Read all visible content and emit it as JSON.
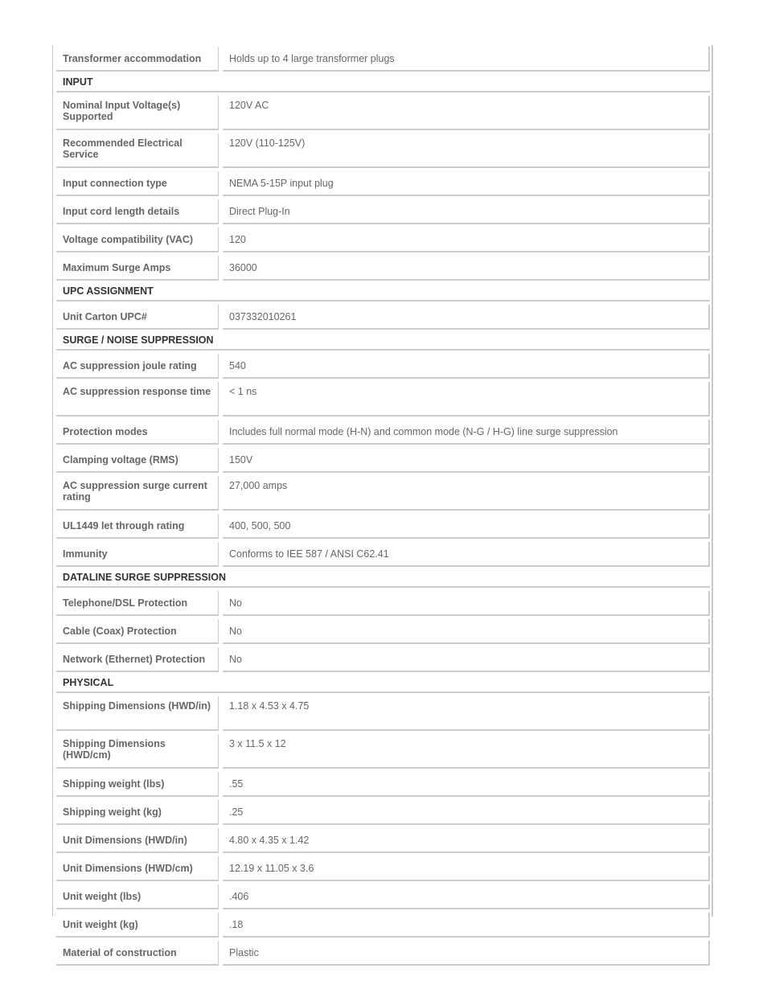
{
  "spec_table": {
    "rows": [
      {
        "type": "row",
        "label": "Transformer accommodation",
        "value": "Holds up to 4 large transformer plugs"
      },
      {
        "type": "section",
        "label": "INPUT"
      },
      {
        "type": "row",
        "label": "Nominal Input Voltage(s) Supported",
        "value": "120V AC",
        "tall": true
      },
      {
        "type": "row",
        "label": "Recommended Electrical Service",
        "value": "120V (110-125V)",
        "tall": true
      },
      {
        "type": "row",
        "label": "Input connection type",
        "value": "NEMA 5-15P input plug"
      },
      {
        "type": "row",
        "label": "Input cord length details",
        "value": "Direct Plug-In"
      },
      {
        "type": "row",
        "label": "Voltage compatibility (VAC)",
        "value": "120"
      },
      {
        "type": "row",
        "label": "Maximum Surge Amps",
        "value": "36000"
      },
      {
        "type": "section",
        "label": "UPC ASSIGNMENT"
      },
      {
        "type": "row",
        "label": "Unit Carton UPC#",
        "value": "037332010261"
      },
      {
        "type": "section",
        "label": "SURGE / NOISE SUPPRESSION"
      },
      {
        "type": "row",
        "label": "AC suppression joule rating",
        "value": "540"
      },
      {
        "type": "row",
        "label": "AC suppression response time",
        "value": "< 1 ns",
        "tall": true
      },
      {
        "type": "row",
        "label": "Protection modes",
        "value": "Includes full normal mode (H-N) and common mode (N-G / H-G) line surge suppression"
      },
      {
        "type": "row",
        "label": "Clamping voltage (RMS)",
        "value": "150V"
      },
      {
        "type": "row",
        "label": "AC suppression surge current rating",
        "value": "27,000 amps",
        "tall": true
      },
      {
        "type": "row",
        "label": "UL1449 let through rating",
        "value": "400, 500, 500"
      },
      {
        "type": "row",
        "label": "Immunity",
        "value": "Conforms to IEE 587 / ANSI C62.41"
      },
      {
        "type": "section",
        "label": "DATALINE SURGE SUPPRESSION"
      },
      {
        "type": "row",
        "label": "Telephone/DSL Protection",
        "value": "No"
      },
      {
        "type": "row",
        "label": "Cable (Coax) Protection",
        "value": "No"
      },
      {
        "type": "row",
        "label": "Network (Ethernet) Protection",
        "value": "No"
      },
      {
        "type": "section",
        "label": "PHYSICAL"
      },
      {
        "type": "row",
        "label": "Shipping Dimensions (HWD/in)",
        "value": "1.18 x 4.53 x 4.75",
        "tall": true
      },
      {
        "type": "row",
        "label": "Shipping Dimensions (HWD/cm)",
        "value": "3 x 11.5 x 12",
        "tall": true
      },
      {
        "type": "row",
        "label": "Shipping weight (lbs)",
        "value": ".55"
      },
      {
        "type": "row",
        "label": "Shipping weight (kg)",
        "value": ".25"
      },
      {
        "type": "row",
        "label": "Unit Dimensions (HWD/in)",
        "value": "4.80 x 4.35 x 1.42"
      },
      {
        "type": "row",
        "label": "Unit Dimensions (HWD/cm)",
        "value": "12.19 x 11.05 x 3.6"
      },
      {
        "type": "row",
        "label": "Unit weight (lbs)",
        "value": ".406"
      },
      {
        "type": "row",
        "label": "Unit weight (kg)",
        "value": ".18"
      },
      {
        "type": "row",
        "label": "Material of construction",
        "value": "Plastic"
      }
    ]
  }
}
